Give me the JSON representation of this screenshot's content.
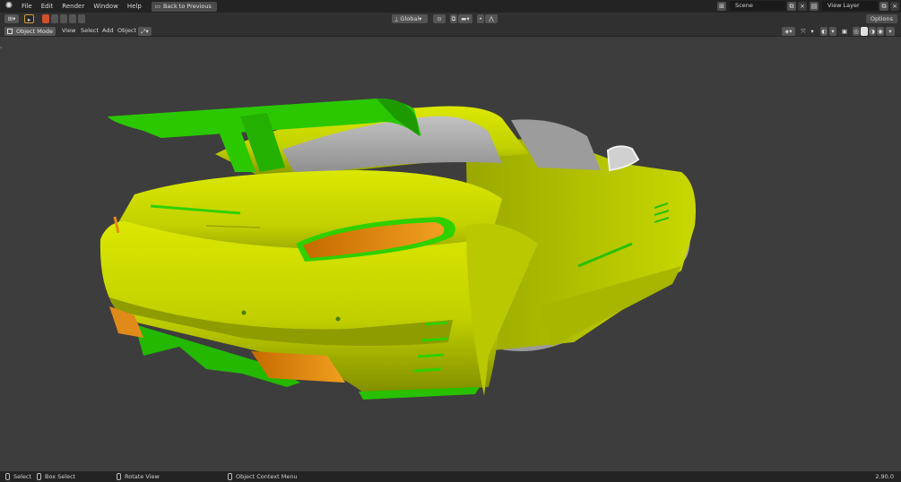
{
  "topbar": {
    "menus": [
      "File",
      "Edit",
      "Render",
      "Window",
      "Help"
    ],
    "back_button": "Back to Previous",
    "scene": "Scene",
    "view_layer": "View Layer"
  },
  "toolbar": {
    "orientation": "Global",
    "options_label": "Options"
  },
  "header": {
    "mode": "Object Mode",
    "menus": [
      "View",
      "Select",
      "Add",
      "Object"
    ]
  },
  "statusbar": {
    "select": "Select",
    "box_select": "Box Select",
    "rotate_view": "Rotate View",
    "context_menu": "Object Context Menu",
    "version": "2.90.0"
  },
  "colors": {
    "body": "#c4d400",
    "trim": "#2fd000",
    "lights": "#e88a10",
    "glass": "#a8a8a8",
    "viewport": "#3d3d3d"
  }
}
